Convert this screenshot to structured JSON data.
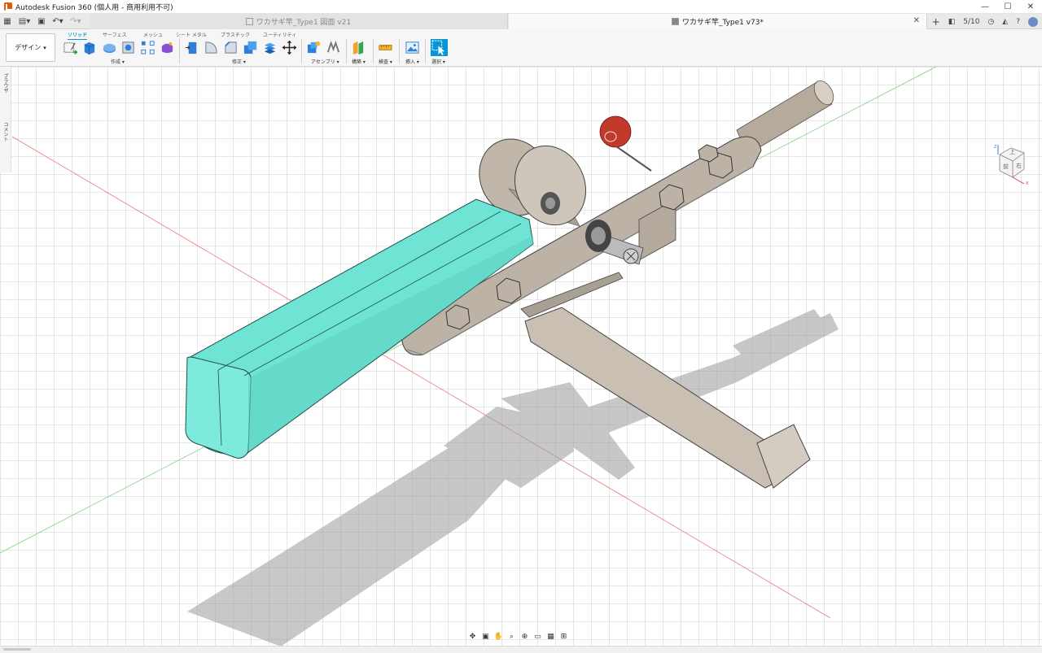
{
  "window": {
    "title": "Autodesk Fusion 360 (個人用 - 商用利用不可)",
    "minimize": "—",
    "maximize": "☐",
    "close": "✕"
  },
  "tabs": {
    "inactive_label": "ワカサギ竿_Type1 図面 v21",
    "active_label": "ワカサギ竿_Type1 v73*",
    "job_status": "5/10",
    "plus": "+",
    "close": "✕"
  },
  "toolbar": {
    "workspace": "デザイン",
    "tabs": [
      "ソリッド",
      "サーフェス",
      "メッシュ",
      "シート メタル",
      "プラスチック",
      "ユーティリティ"
    ],
    "groups": [
      "作成 ▾",
      "修正 ▾",
      "アセンブリ ▾",
      "構築 ▾",
      "検査 ▾",
      "挿入 ▾",
      "選択 ▾"
    ]
  },
  "left_panel": {
    "browser_label": "ブラウザ",
    "comment_label": "コメント"
  },
  "viewcube": {
    "top": "上",
    "front": "前",
    "right": "右",
    "axis_x": "X",
    "axis_z": "Z"
  },
  "colors": {
    "accent": "#0696d7",
    "handle": "#6fe3d4",
    "metal": "#b9afa4",
    "ball": "#c0392b"
  }
}
